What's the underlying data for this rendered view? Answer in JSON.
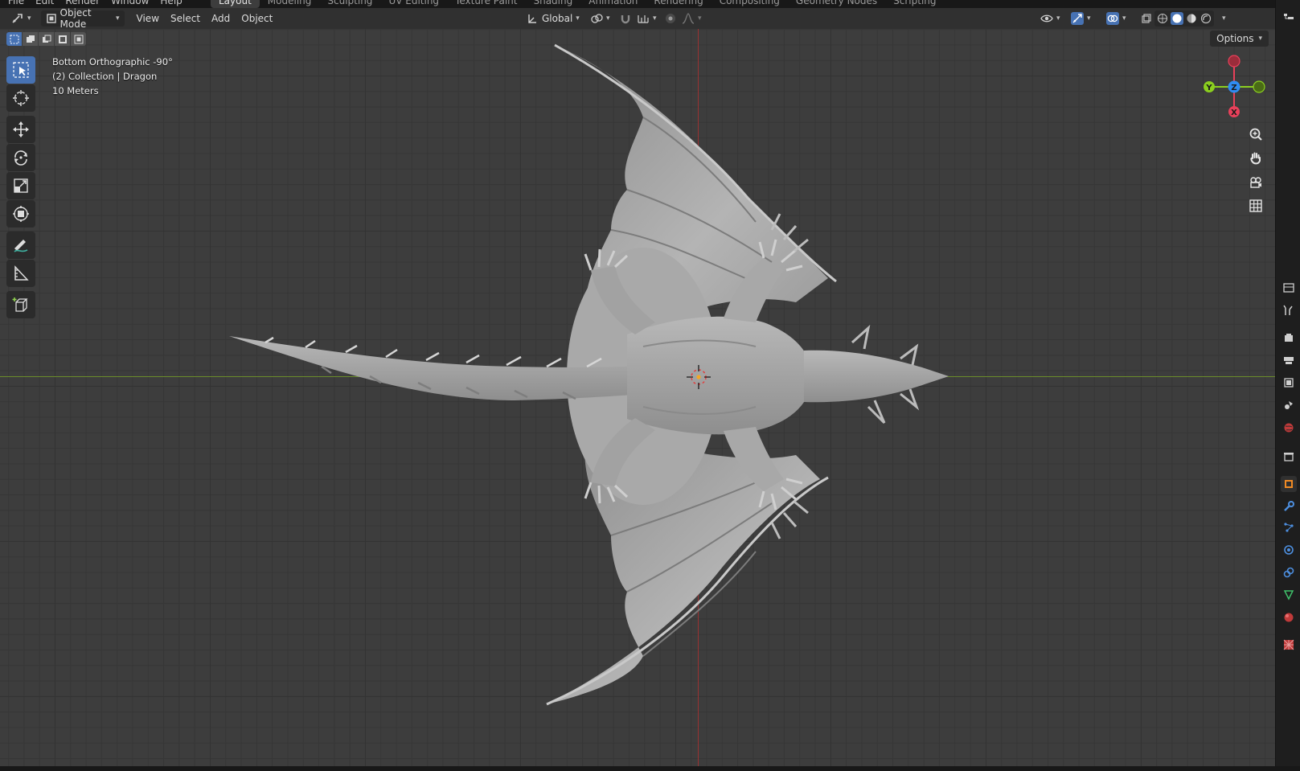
{
  "topbar": {
    "menus": [
      "File",
      "Edit",
      "Render",
      "Window",
      "Help"
    ],
    "workspaces": [
      "Layout",
      "Modeling",
      "Sculpting",
      "UV Editing",
      "Texture Paint",
      "Shading",
      "Animation",
      "Rendering",
      "Compositing",
      "Geometry Nodes",
      "Scripting"
    ],
    "active_workspace": "Layout"
  },
  "header": {
    "mode": "Object Mode",
    "menus": [
      "View",
      "Select",
      "Add",
      "Object"
    ],
    "transform_orientation": "Global",
    "options_label": "Options"
  },
  "viewport": {
    "view_name": "Bottom Orthographic -90°",
    "collection": "(2) Collection | Dragon",
    "scale": "10 Meters",
    "gizmo": {
      "x": "X",
      "y": "Y",
      "z": "Z"
    },
    "axis_colors": {
      "x": "#e8405a",
      "y": "#8bcf1f",
      "z": "#2f8cf2"
    },
    "model": "dragon-sculpt"
  },
  "toolbar": {
    "tools": [
      "select-box",
      "cursor",
      "move",
      "rotate",
      "scale",
      "transform",
      "annotate",
      "measure",
      "add-cube"
    ],
    "active_tool": "select-box"
  },
  "colors": {
    "accent": "#4772b3",
    "header_bg": "#303030",
    "viewport_bg": "#3d3d3d"
  }
}
